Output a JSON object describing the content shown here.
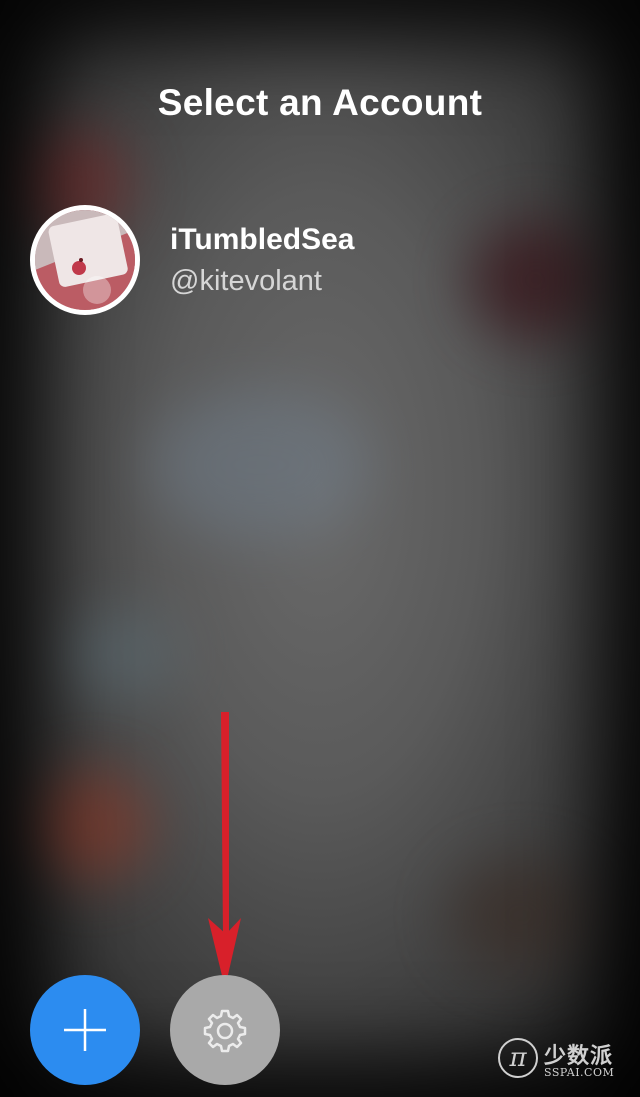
{
  "header": {
    "title": "Select an Account"
  },
  "accounts": [
    {
      "name": "iTumbledSea",
      "handle": "@kitevolant"
    }
  ],
  "actions": {
    "add_icon": "plus-icon",
    "settings_icon": "gear-icon"
  },
  "colors": {
    "add_button": "#2c8cf0",
    "settings_button": "#a9a9a9",
    "arrow": "#d8202a"
  },
  "watermark": {
    "cn": "少数派",
    "en": "SSPAI.COM",
    "logo": "π"
  }
}
